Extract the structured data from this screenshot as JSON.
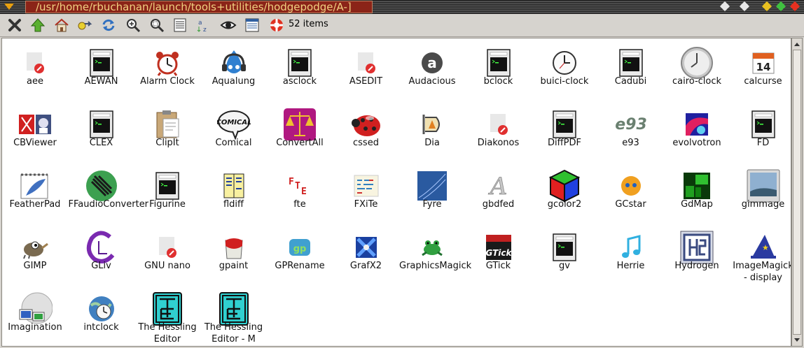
{
  "window": {
    "title": "/usr/home/rbuchanan/launch/tools+utilities/hodgepodge/A-]"
  },
  "toolbar": {
    "item_count": "52 items"
  },
  "colors": {
    "titlebar": "#8b2418",
    "title_text": "#f0d080",
    "background": "#d6d3ce",
    "content_bg": "#ffffff"
  },
  "items": [
    {
      "label": "aee",
      "icon": "broken-icon"
    },
    {
      "label": "AEWAN",
      "icon": "terminal-icon"
    },
    {
      "label": "Alarm Clock",
      "icon": "alarm-clock-icon"
    },
    {
      "label": "Aqualung",
      "icon": "aqualung-icon"
    },
    {
      "label": "asclock",
      "icon": "terminal-icon"
    },
    {
      "label": "ASEDIT",
      "icon": "broken-icon"
    },
    {
      "label": "Audacious",
      "icon": "audacious-icon"
    },
    {
      "label": "bclock",
      "icon": "terminal-icon"
    },
    {
      "label": "buici-clock",
      "icon": "clock-icon"
    },
    {
      "label": "Cadubi",
      "icon": "terminal-icon"
    },
    {
      "label": "cairo-clock",
      "icon": "clock-large-icon"
    },
    {
      "label": "calcurse",
      "icon": "calendar-icon"
    },
    {
      "label": "CBViewer",
      "icon": "cbviewer-icon"
    },
    {
      "label": "CLEX",
      "icon": "terminal-icon"
    },
    {
      "label": "ClipIt",
      "icon": "clipboard-icon"
    },
    {
      "label": "Comical",
      "icon": "comical-icon"
    },
    {
      "label": "ConvertAll",
      "icon": "scales-icon"
    },
    {
      "label": "cssed",
      "icon": "ladybug-icon"
    },
    {
      "label": "Dia",
      "icon": "dia-icon"
    },
    {
      "label": "Diakonos",
      "icon": "broken-icon"
    },
    {
      "label": "DiffPDF",
      "icon": "terminal-icon"
    },
    {
      "label": "e93",
      "icon": "e93-icon"
    },
    {
      "label": "evolvotron",
      "icon": "evolvotron-icon"
    },
    {
      "label": "FD",
      "icon": "terminal-icon"
    },
    {
      "label": "FeatherPad",
      "icon": "featherpad-icon"
    },
    {
      "label": "FFaudioConverter",
      "icon": "ffaudio-icon"
    },
    {
      "label": "Figurine",
      "icon": "terminal-icon"
    },
    {
      "label": "fldiff",
      "icon": "fldiff-icon"
    },
    {
      "label": "fte",
      "icon": "fte-icon"
    },
    {
      "label": "FXiTe",
      "icon": "fxite-icon"
    },
    {
      "label": "Fyre",
      "icon": "fyre-icon"
    },
    {
      "label": "gbdfed",
      "icon": "gbdfed-icon"
    },
    {
      "label": "gcolor2",
      "icon": "cube-icon"
    },
    {
      "label": "GCstar",
      "icon": "gcstar-icon"
    },
    {
      "label": "GdMap",
      "icon": "gdmap-icon"
    },
    {
      "label": "gimmage",
      "icon": "gimmage-icon"
    },
    {
      "label": "GIMP",
      "icon": "gimp-icon"
    },
    {
      "label": "GLiv",
      "icon": "gliv-icon"
    },
    {
      "label": "GNU nano",
      "icon": "broken-icon"
    },
    {
      "label": "gpaint",
      "icon": "gpaint-icon"
    },
    {
      "label": "GPRename",
      "icon": "gprename-icon"
    },
    {
      "label": "GrafX2",
      "icon": "grafx2-icon"
    },
    {
      "label": "GraphicsMagick",
      "icon": "frog-icon"
    },
    {
      "label": "GTick",
      "icon": "gtick-icon"
    },
    {
      "label": "gv",
      "icon": "terminal-icon"
    },
    {
      "label": "Herrie",
      "icon": "music-note-icon"
    },
    {
      "label": "Hydrogen",
      "icon": "hydrogen-icon"
    },
    {
      "label": "ImageMagick - display",
      "icon": "wizard-hat-icon"
    },
    {
      "label": "Imagination",
      "icon": "imagination-icon"
    },
    {
      "label": "intclock",
      "icon": "globe-clock-icon"
    },
    {
      "label": "The Hessling Editor",
      "icon": "the-icon"
    },
    {
      "label": "The Hessling Editor - M",
      "icon": "the-icon"
    }
  ]
}
